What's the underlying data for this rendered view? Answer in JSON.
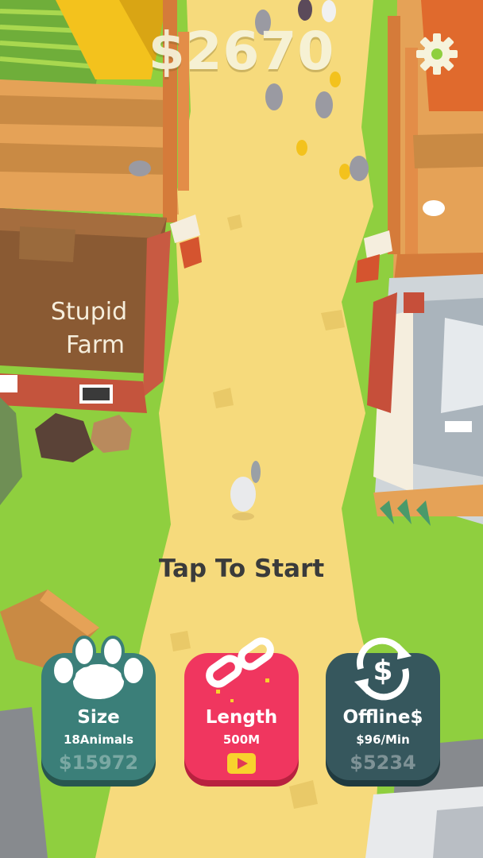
{
  "hud": {
    "money": "$2670",
    "settings_icon": "gear-icon"
  },
  "scene": {
    "barn_sign_line1": "Stupid",
    "barn_sign_line2": "Farm",
    "prompt": "Tap To Start"
  },
  "upgrades": [
    {
      "title": "Size",
      "subtitle": "18Animals",
      "cost": "$15972",
      "icon": "paw-icon",
      "color": "#3b7f79"
    },
    {
      "title": "Length",
      "subtitle": "500M",
      "cost": "",
      "icon": "chain-link-icon",
      "extra_icon": "video-ad-icon",
      "color": "#f0365f"
    },
    {
      "title": "Offline$",
      "subtitle": "$96/Min",
      "cost": "$5234",
      "icon": "dollar-cycle-icon",
      "color": "#36575d"
    }
  ]
}
